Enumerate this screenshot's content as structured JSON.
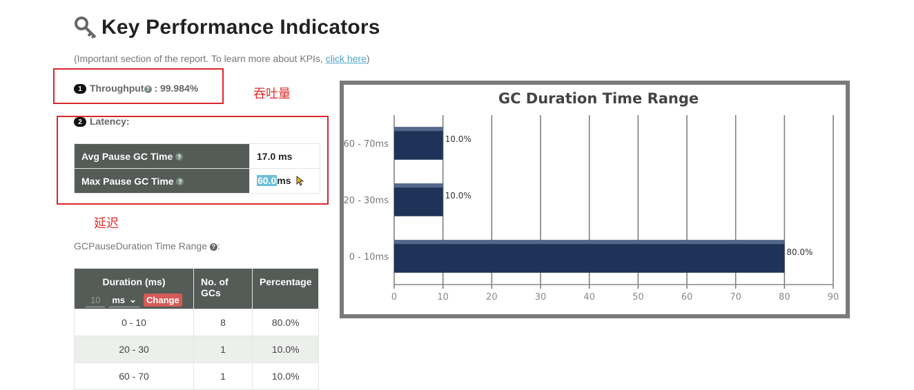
{
  "header": {
    "title": "Key Performance Indicators",
    "intro_prefix": "(Important section of the report. To learn more about KPIs, ",
    "intro_link": "click here",
    "intro_suffix": ")"
  },
  "throughput": {
    "number": "1",
    "label": "Throughput",
    "help": "?",
    "value": " : 99.984%",
    "annotation": "吞吐量"
  },
  "latency": {
    "number": "2",
    "label": "Latency:",
    "annotation": "延迟",
    "rows": [
      {
        "label": "Avg Pause GC Time",
        "value": "17.0 ms"
      },
      {
        "label": "Max Pause GC Time",
        "value_highlight": "60.0",
        "value_unit": "ms"
      }
    ]
  },
  "gc_pause_range": {
    "label": "GCPauseDuration Time Range",
    "table": {
      "headers": [
        "Duration (ms)",
        "No. of GCs",
        "Percentage"
      ],
      "input_value": "10",
      "unit_select": "ms",
      "change_label": "Change",
      "rows": [
        {
          "duration": "0 - 10",
          "count": "8",
          "percentage": "80.0%"
        },
        {
          "duration": "20 - 30",
          "count": "1",
          "percentage": "10.0%"
        },
        {
          "duration": "60 - 70",
          "count": "1",
          "percentage": "10.0%"
        }
      ]
    }
  },
  "chart_data": {
    "type": "bar",
    "orientation": "horizontal",
    "title": "GC Duration Time Range",
    "categories": [
      "60 - 70ms",
      "20 - 30ms",
      "0 - 10ms"
    ],
    "values": [
      10,
      10,
      80
    ],
    "data_labels": [
      "10.0%",
      "10.0%",
      "80.0%"
    ],
    "xlim": [
      0,
      90
    ],
    "x_ticks": [
      0,
      10,
      20,
      30,
      40,
      50,
      60,
      70,
      80,
      90
    ],
    "grid": true,
    "bar_color": "#1f3358"
  },
  "colors": {
    "table_header_bg": "#555b57",
    "annotation_red": "#d9262c",
    "highlight": "#6dbfd8",
    "change_button": "#d45b58"
  }
}
